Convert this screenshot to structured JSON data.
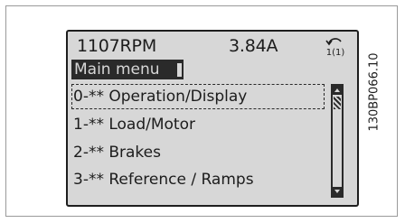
{
  "status_line": {
    "speed": "1107RPM",
    "current": "3.84A",
    "setup_icon_label": "1(1)",
    "icon": "setup-selection-icon"
  },
  "title": {
    "text": "Main menu"
  },
  "menu": {
    "items": [
      {
        "label": "0-** Operation/Display",
        "selected": true
      },
      {
        "label": "1-** Load/Motor",
        "selected": false
      },
      {
        "label": "2-** Brakes",
        "selected": false
      },
      {
        "label": "3-** Reference / Ramps",
        "selected": false
      }
    ]
  },
  "scrollbar": {
    "up_icon": "scroll-up-arrow-icon",
    "down_icon": "scroll-down-arrow-icon"
  },
  "figure_code": "130BP066.10",
  "colors": {
    "lcd_background": "#d7d7d7",
    "lcd_text": "#1c1c1c",
    "highlight_bar": "#2a2a2a"
  }
}
